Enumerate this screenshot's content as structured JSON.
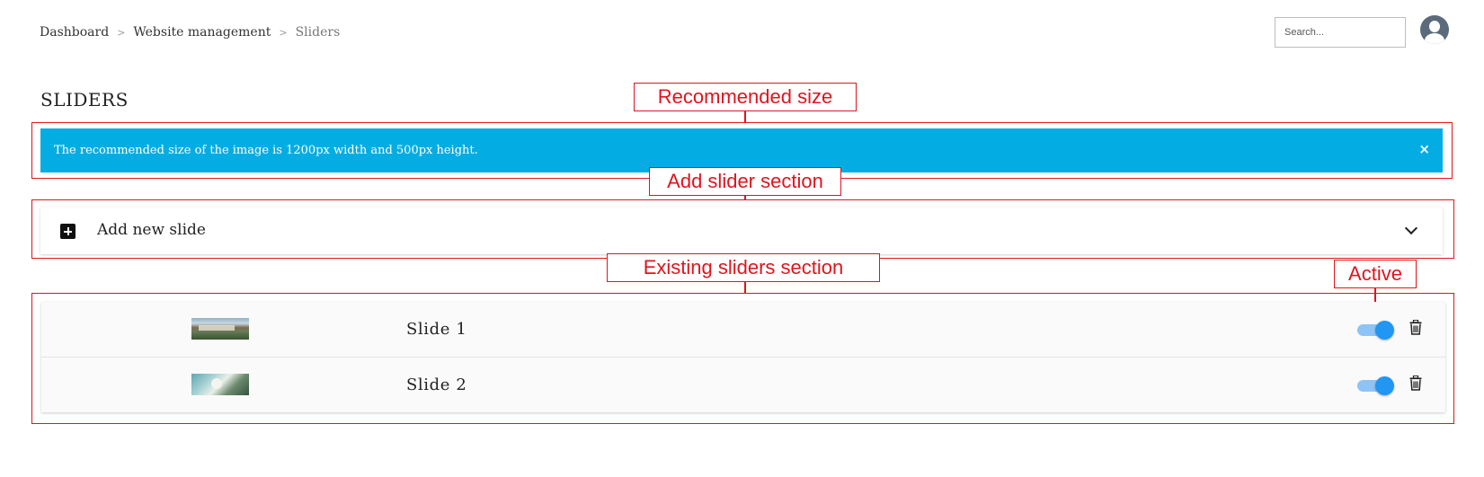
{
  "breadcrumb": {
    "items": [
      "Dashboard",
      "Website management",
      "Sliders"
    ],
    "separator": ">"
  },
  "search": {
    "placeholder": "Search...",
    "value": ""
  },
  "page": {
    "title": "SLIDERS"
  },
  "alert": {
    "message": "The recommended size of the image is 1200px width and 500px height.",
    "close_label": "×",
    "color": "#03ade3"
  },
  "add_slide": {
    "label": "Add new slide",
    "icon": "plus-square-icon",
    "expand_icon": "chevron-down-icon"
  },
  "slides": [
    {
      "name": "Slide 1",
      "active": true
    },
    {
      "name": "Slide 2",
      "active": true
    }
  ],
  "annotations": {
    "recommended_size": "Recommended size",
    "add_slider_section": "Add slider section",
    "existing_sliders_section": "Existing sliders section",
    "active": "Active",
    "color": "#e0141e"
  },
  "colors": {
    "toggle_on": "#2196f3",
    "toggle_track": "#8ec4f5"
  }
}
